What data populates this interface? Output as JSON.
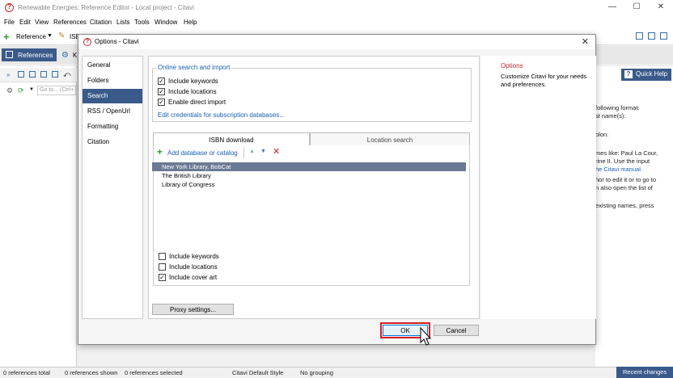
{
  "window": {
    "title": "Renewable Energies: Reference Editor - Local project - Citavi",
    "controls": {
      "minimize": "—",
      "maximize": "☐",
      "close": "✕"
    }
  },
  "menu": [
    "File",
    "Edit",
    "View",
    "References",
    "Citation",
    "Lists",
    "Tools",
    "Window",
    "Help"
  ],
  "toolbar": {
    "reference_label": "Reference",
    "isbn_label": "ISB"
  },
  "tabs": {
    "references": "References",
    "knowledge": "K"
  },
  "left_pane": {
    "goto_placeholder": "Go to... (Ctrl+"
  },
  "right_pane": {
    "quick_help": "Quick Help",
    "lines": [
      "following format:",
      "st name(s):",
      "",
      "olon:",
      "",
      "mes like: Paul La Cour,",
      "rine II. Use the input",
      "he Citavi manual.",
      "",
      "hor to edit it or to go to",
      "n also open the list of",
      "",
      "existing names, press"
    ]
  },
  "dialog": {
    "title": "Options - Citavi",
    "nav": [
      "General",
      "Folders",
      "Search",
      "RSS / OpenUrl",
      "Formatting",
      "Citation"
    ],
    "selected_nav": "Search",
    "online": {
      "legend": "Online search and import",
      "options": [
        {
          "label": "Include keywords",
          "checked": true
        },
        {
          "label": "Include locations",
          "checked": true
        },
        {
          "label": "Enable direct import",
          "checked": true
        }
      ],
      "credentials_link": "Edit credentials for subscription databases..."
    },
    "tabs": [
      "ISBN download",
      "Location search"
    ],
    "add_db_label": "Add database or catalog",
    "databases": [
      "New York Library, BobCat",
      "The British Library",
      "Library of Congress"
    ],
    "selected_db": "New York Library, BobCat",
    "isbn_options": [
      {
        "label": "Include keywords",
        "checked": false
      },
      {
        "label": "Include locations",
        "checked": false
      },
      {
        "label": "Include cover art",
        "checked": true
      }
    ],
    "proxy_button": "Proxy settings...",
    "ok": "OK",
    "cancel": "Cancel",
    "info": {
      "heading": "Options",
      "description": "Customize Citavi for your needs and preferences."
    }
  },
  "status": {
    "total": "0 references total",
    "shown": "0 references shown",
    "selected": "0 references selected",
    "style": "Citavi Default Style",
    "grouping": "No grouping",
    "recent": "Recent changes"
  },
  "colors": {
    "accent": "#3a5a8a",
    "highlight": "#d41f1f",
    "link": "#1a5fb4"
  }
}
